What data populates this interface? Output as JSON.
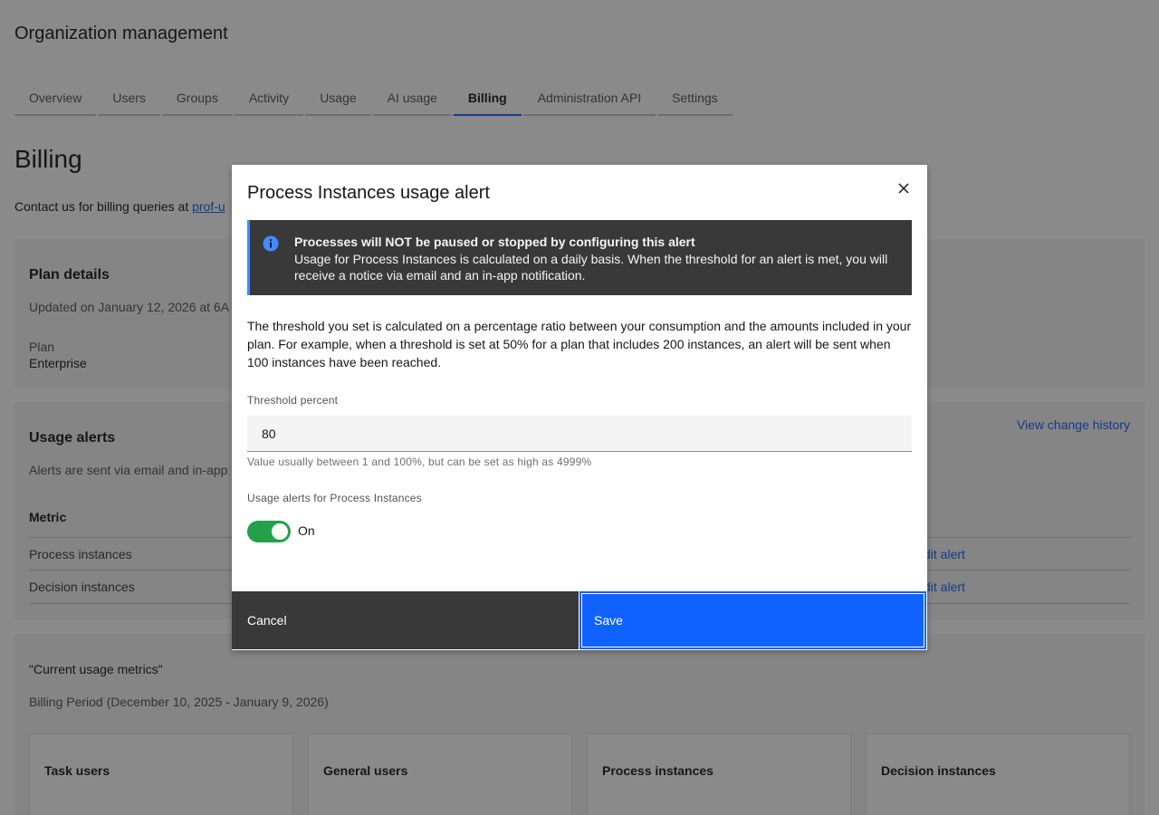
{
  "page": {
    "org_title": "Organization management",
    "tabs": [
      {
        "label": "Overview"
      },
      {
        "label": "Users"
      },
      {
        "label": "Groups"
      },
      {
        "label": "Activity"
      },
      {
        "label": "Usage"
      },
      {
        "label": "AI usage"
      },
      {
        "label": "Billing",
        "active": true
      },
      {
        "label": "Administration API"
      },
      {
        "label": "Settings"
      }
    ],
    "billing_title": "Billing",
    "contact_prefix": "Contact us for billing queries at ",
    "contact_link": "prof-u",
    "plan": {
      "heading": "Plan details",
      "updated": "Updated on January 12, 2026 at 6A",
      "plan_label": "Plan",
      "plan_value": "Enterprise"
    },
    "alerts": {
      "heading": "Usage alerts",
      "subtext": "Alerts are sent via email and in-app",
      "history_link": "View change history",
      "metric_header": "Metric",
      "rows": [
        {
          "metric": "Process instances",
          "action": "dit alert"
        },
        {
          "metric": "Decision instances",
          "action": "dit alert"
        }
      ]
    },
    "metrics": {
      "heading": "\"Current usage metrics\"",
      "period": "Billing Period (December 10, 2025 - January 9, 2026)",
      "cards": [
        {
          "title": "Task users"
        },
        {
          "title": "General users"
        },
        {
          "title": "Process instances"
        },
        {
          "title": "Decision instances"
        }
      ]
    }
  },
  "modal": {
    "title": "Process Instances usage alert",
    "notification": {
      "title": "Processes will NOT be paused or stopped by configuring this alert",
      "body": "Usage for Process Instances is calculated on a daily basis. When the threshold for an alert is met, you will receive a notice via email and an in-app notification."
    },
    "description": "The threshold you set is calculated on a percentage ratio between your consumption and the amounts included in your plan. For example, when a threshold is set at 50% for a plan that includes 200 instances, an alert will be sent when 100 instances have been reached.",
    "threshold": {
      "label": "Threshold percent",
      "value": "80",
      "helper": "Value usually between 1 and 100%, but can be set as high as 4999%"
    },
    "toggle": {
      "label": "Usage alerts for Process Instances",
      "state": "On",
      "on": true
    },
    "cancel_label": "Cancel",
    "save_label": "Save"
  },
  "colors": {
    "primary": "#0f62fe",
    "toggle_on": "#24a148",
    "notification_bg": "#393939",
    "notification_accent": "#4589ff"
  },
  "icons": {
    "close": "close-icon",
    "info": "info-icon"
  }
}
